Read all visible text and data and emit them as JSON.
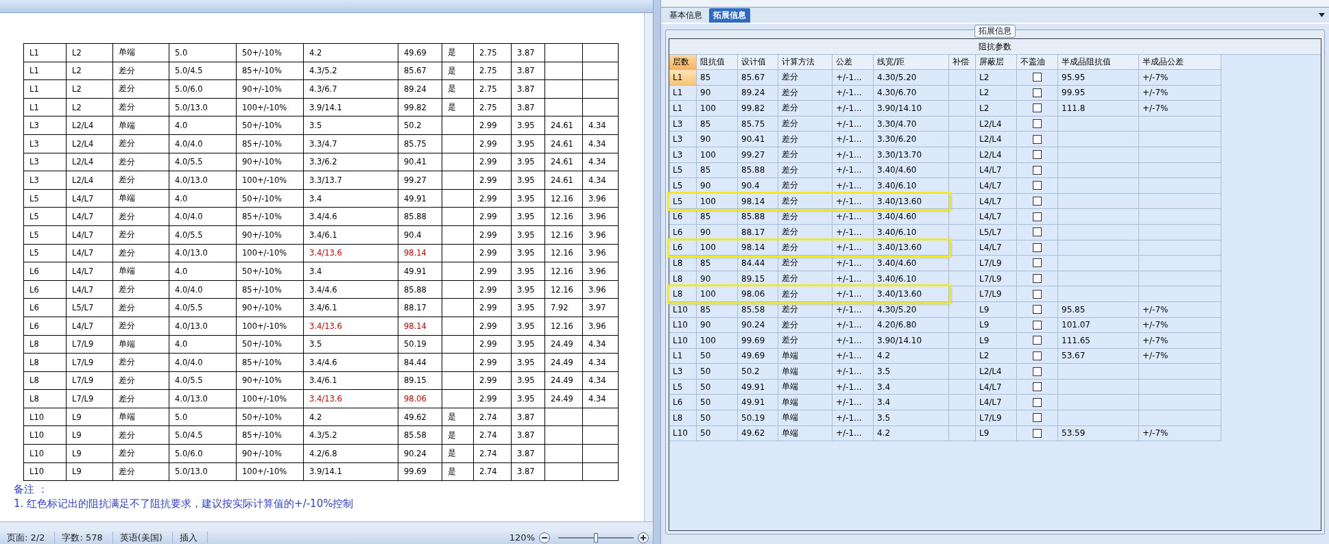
{
  "document": {
    "table": {
      "rows": [
        {
          "cells": [
            "L1",
            "L2",
            "单端",
            "5.0",
            "50+/-10%",
            "4.2",
            "49.69",
            "是",
            "2.75",
            "3.87",
            null,
            null
          ],
          "flagged": false
        },
        {
          "cells": [
            "L1",
            "L2",
            "差分",
            "5.0/4.5",
            "85+/-10%",
            "4.3/5.2",
            "85.67",
            "是",
            "2.75",
            "3.87",
            null,
            null
          ],
          "flagged": false
        },
        {
          "cells": [
            "L1",
            "L2",
            "差分",
            "5.0/6.0",
            "90+/-10%",
            "4.3/6.7",
            "89.24",
            "是",
            "2.75",
            "3.87",
            null,
            null
          ],
          "flagged": false
        },
        {
          "cells": [
            "L1",
            "L2",
            "差分",
            "5.0/13.0",
            "100+/-10%",
            "3.9/14.1",
            "99.82",
            "是",
            "2.75",
            "3.87",
            null,
            null
          ],
          "flagged": false
        },
        {
          "cells": [
            "L3",
            "L2/L4",
            "单端",
            "4.0",
            "50+/-10%",
            "3.5",
            "50.2",
            null,
            "2.99",
            "3.95",
            "24.61",
            "4.34"
          ],
          "flagged": false
        },
        {
          "cells": [
            "L3",
            "L2/L4",
            "差分",
            "4.0/4.0",
            "85+/-10%",
            "3.3/4.7",
            "85.75",
            null,
            "2.99",
            "3.95",
            "24.61",
            "4.34"
          ],
          "flagged": false
        },
        {
          "cells": [
            "L3",
            "L2/L4",
            "差分",
            "4.0/5.5",
            "90+/-10%",
            "3.3/6.2",
            "90.41",
            null,
            "2.99",
            "3.95",
            "24.61",
            "4.34"
          ],
          "flagged": false
        },
        {
          "cells": [
            "L3",
            "L2/L4",
            "差分",
            "4.0/13.0",
            "100+/-10%",
            "3.3/13.7",
            "99.27",
            null,
            "2.99",
            "3.95",
            "24.61",
            "4.34"
          ],
          "flagged": false
        },
        {
          "cells": [
            "L5",
            "L4/L7",
            "单端",
            "4.0",
            "50+/-10%",
            "3.4",
            "49.91",
            null,
            "2.99",
            "3.95",
            "12.16",
            "3.96"
          ],
          "flagged": false
        },
        {
          "cells": [
            "L5",
            "L4/L7",
            "差分",
            "4.0/4.0",
            "85+/-10%",
            "3.4/4.6",
            "85.88",
            null,
            "2.99",
            "3.95",
            "12.16",
            "3.96"
          ],
          "flagged": false
        },
        {
          "cells": [
            "L5",
            "L4/L7",
            "差分",
            "4.0/5.5",
            "90+/-10%",
            "3.4/6.1",
            "90.4",
            null,
            "2.99",
            "3.95",
            "12.16",
            "3.96"
          ],
          "flagged": false
        },
        {
          "cells": [
            "L5",
            "L4/L7",
            "差分",
            "4.0/13.0",
            "100+/-10%",
            "3.4/13.6",
            "98.14",
            null,
            "2.99",
            "3.95",
            "12.16",
            "3.96"
          ],
          "flagged": true
        },
        {
          "cells": [
            "L6",
            "L4/L7",
            "单端",
            "4.0",
            "50+/-10%",
            "3.4",
            "49.91",
            null,
            "2.99",
            "3.95",
            "12.16",
            "3.96"
          ],
          "flagged": false
        },
        {
          "cells": [
            "L6",
            "L4/L7",
            "差分",
            "4.0/4.0",
            "85+/-10%",
            "3.4/4.6",
            "85.88",
            null,
            "2.99",
            "3.95",
            "12.16",
            "3.96"
          ],
          "flagged": false
        },
        {
          "cells": [
            "L6",
            "L5/L7",
            "差分",
            "4.0/5.5",
            "90+/-10%",
            "3.4/6.1",
            "88.17",
            null,
            "2.99",
            "3.95",
            "7.92",
            "3.97"
          ],
          "flagged": false
        },
        {
          "cells": [
            "L6",
            "L4/L7",
            "差分",
            "4.0/13.0",
            "100+/-10%",
            "3.4/13.6",
            "98.14",
            null,
            "2.99",
            "3.95",
            "12.16",
            "3.96"
          ],
          "flagged": true
        },
        {
          "cells": [
            "L8",
            "L7/L9",
            "单端",
            "4.0",
            "50+/-10%",
            "3.5",
            "50.19",
            null,
            "2.99",
            "3.95",
            "24.49",
            "4.34"
          ],
          "flagged": false
        },
        {
          "cells": [
            "L8",
            "L7/L9",
            "差分",
            "4.0/4.0",
            "85+/-10%",
            "3.4/4.6",
            "84.44",
            null,
            "2.99",
            "3.95",
            "24.49",
            "4.34"
          ],
          "flagged": false
        },
        {
          "cells": [
            "L8",
            "L7/L9",
            "差分",
            "4.0/5.5",
            "90+/-10%",
            "3.4/6.1",
            "89.15",
            null,
            "2.99",
            "3.95",
            "24.49",
            "4.34"
          ],
          "flagged": false
        },
        {
          "cells": [
            "L8",
            "L7/L9",
            "差分",
            "4.0/13.0",
            "100+/-10%",
            "3.4/13.6",
            "98.06",
            null,
            "2.99",
            "3.95",
            "24.49",
            "4.34"
          ],
          "flagged": true
        },
        {
          "cells": [
            "L10",
            "L9",
            "单端",
            "5.0",
            "50+/-10%",
            "4.2",
            "49.62",
            "是",
            "2.74",
            "3.87",
            null,
            null
          ],
          "flagged": false
        },
        {
          "cells": [
            "L10",
            "L9",
            "差分",
            "5.0/4.5",
            "85+/-10%",
            "4.3/5.2",
            "85.58",
            "是",
            "2.74",
            "3.87",
            null,
            null
          ],
          "flagged": false
        },
        {
          "cells": [
            "L10",
            "L9",
            "差分",
            "5.0/6.0",
            "90+/-10%",
            "4.2/6.8",
            "90.24",
            "是",
            "2.74",
            "3.87",
            null,
            null
          ],
          "flagged": false
        },
        {
          "cells": [
            "L10",
            "L9",
            "差分",
            "5.0/13.0",
            "100+/-10%",
            "3.9/14.1",
            "99.69",
            "是",
            "2.74",
            "3.87",
            null,
            null
          ],
          "flagged": false
        }
      ]
    },
    "notes_heading": "备注 ：",
    "notes": [
      "1. 红色标记出的阻抗满足不了阻抗要求，建议按实际计算值的+/-10%控制"
    ]
  },
  "status_bar": {
    "page": "页面: 2/2",
    "word_count": "字数: 578",
    "language": "英语(美国)",
    "mode": "插入",
    "zoom": "120%",
    "zoom_slider": {
      "level": 0.5
    }
  },
  "panel": {
    "tabs": [
      {
        "label": "基本信息",
        "selected": false
      },
      {
        "label": "拓展信息",
        "selected": true
      }
    ],
    "group_title": "拓展信息",
    "grid": {
      "title": "阻抗参数",
      "columns": [
        {
          "label": "层数",
          "selected": true,
          "kind": "text"
        },
        {
          "label": "阻抗值",
          "selected": false,
          "kind": "text"
        },
        {
          "label": "设计值",
          "selected": false,
          "kind": "text"
        },
        {
          "label": "计算方法",
          "selected": false,
          "kind": "text"
        },
        {
          "label": "公差",
          "selected": false,
          "kind": "text"
        },
        {
          "label": "线宽/距",
          "selected": false,
          "kind": "text"
        },
        {
          "label": "补偿",
          "selected": false,
          "kind": "text"
        },
        {
          "label": "屏蔽层",
          "selected": false,
          "kind": "text"
        },
        {
          "label": "不盖油",
          "selected": false,
          "kind": "checkbox"
        },
        {
          "label": "半成品阻抗值",
          "selected": false,
          "kind": "text"
        },
        {
          "label": "半成品公差",
          "selected": false,
          "kind": "text"
        }
      ],
      "rows": [
        {
          "cells": [
            "L1",
            "85",
            "85.67",
            "差分",
            "+/-1...",
            "4.30/5.20",
            null,
            "L2",
            null,
            "95.95",
            "+/-7%"
          ],
          "checked": false,
          "highlighted": false,
          "focused": true
        },
        {
          "cells": [
            "L1",
            "90",
            "89.24",
            "差分",
            "+/-1...",
            "4.30/6.70",
            null,
            "L2",
            null,
            "99.95",
            "+/-7%"
          ],
          "checked": false,
          "highlighted": false,
          "focused": false
        },
        {
          "cells": [
            "L1",
            "100",
            "99.82",
            "差分",
            "+/-1...",
            "3.90/14.10",
            null,
            "L2",
            null,
            "111.8",
            "+/-7%"
          ],
          "checked": false,
          "highlighted": false,
          "focused": false
        },
        {
          "cells": [
            "L3",
            "85",
            "85.75",
            "差分",
            "+/-1...",
            "3.30/4.70",
            null,
            "L2/L4",
            null,
            null,
            null
          ],
          "checked": false,
          "highlighted": false,
          "focused": false
        },
        {
          "cells": [
            "L3",
            "90",
            "90.41",
            "差分",
            "+/-1...",
            "3.30/6.20",
            null,
            "L2/L4",
            null,
            null,
            null
          ],
          "checked": false,
          "highlighted": false,
          "focused": false
        },
        {
          "cells": [
            "L3",
            "100",
            "99.27",
            "差分",
            "+/-1...",
            "3.30/13.70",
            null,
            "L2/L4",
            null,
            null,
            null
          ],
          "checked": false,
          "highlighted": false,
          "focused": false
        },
        {
          "cells": [
            "L5",
            "85",
            "85.88",
            "差分",
            "+/-1...",
            "3.40/4.60",
            null,
            "L4/L7",
            null,
            null,
            null
          ],
          "checked": false,
          "highlighted": false,
          "focused": false
        },
        {
          "cells": [
            "L5",
            "90",
            "90.4",
            "差分",
            "+/-1...",
            "3.40/6.10",
            null,
            "L4/L7",
            null,
            null,
            null
          ],
          "checked": false,
          "highlighted": false,
          "focused": false
        },
        {
          "cells": [
            "L5",
            "100",
            "98.14",
            "差分",
            "+/-1...",
            "3.40/13.60",
            null,
            "L4/L7",
            null,
            null,
            null
          ],
          "checked": false,
          "highlighted": true,
          "focused": false
        },
        {
          "cells": [
            "L6",
            "85",
            "85.88",
            "差分",
            "+/-1...",
            "3.40/4.60",
            null,
            "L4/L7",
            null,
            null,
            null
          ],
          "checked": false,
          "highlighted": false,
          "focused": false
        },
        {
          "cells": [
            "L6",
            "90",
            "88.17",
            "差分",
            "+/-1...",
            "3.40/6.10",
            null,
            "L5/L7",
            null,
            null,
            null
          ],
          "checked": false,
          "highlighted": false,
          "focused": false
        },
        {
          "cells": [
            "L6",
            "100",
            "98.14",
            "差分",
            "+/-1...",
            "3.40/13.60",
            null,
            "L4/L7",
            null,
            null,
            null
          ],
          "checked": false,
          "highlighted": true,
          "focused": false
        },
        {
          "cells": [
            "L8",
            "85",
            "84.44",
            "差分",
            "+/-1...",
            "3.40/4.60",
            null,
            "L7/L9",
            null,
            null,
            null
          ],
          "checked": false,
          "highlighted": false,
          "focused": false
        },
        {
          "cells": [
            "L8",
            "90",
            "89.15",
            "差分",
            "+/-1...",
            "3.40/6.10",
            null,
            "L7/L9",
            null,
            null,
            null
          ],
          "checked": false,
          "highlighted": false,
          "focused": false
        },
        {
          "cells": [
            "L8",
            "100",
            "98.06",
            "差分",
            "+/-1...",
            "3.40/13.60",
            null,
            "L7/L9",
            null,
            null,
            null
          ],
          "checked": false,
          "highlighted": true,
          "focused": false
        },
        {
          "cells": [
            "L10",
            "85",
            "85.58",
            "差分",
            "+/-1...",
            "4.30/5.20",
            null,
            "L9",
            null,
            "95.85",
            "+/-7%"
          ],
          "checked": false,
          "highlighted": false,
          "focused": false
        },
        {
          "cells": [
            "L10",
            "90",
            "90.24",
            "差分",
            "+/-1...",
            "4.20/6.80",
            null,
            "L9",
            null,
            "101.07",
            "+/-7%"
          ],
          "checked": false,
          "highlighted": false,
          "focused": false
        },
        {
          "cells": [
            "L10",
            "100",
            "99.69",
            "差分",
            "+/-1...",
            "3.90/14.10",
            null,
            "L9",
            null,
            "111.65",
            "+/-7%"
          ],
          "checked": false,
          "highlighted": false,
          "focused": false
        },
        {
          "cells": [
            "L1",
            "50",
            "49.69",
            "单端",
            "+/-1...",
            "4.2",
            null,
            "L2",
            null,
            "53.67",
            "+/-7%"
          ],
          "checked": false,
          "highlighted": false,
          "focused": false
        },
        {
          "cells": [
            "L3",
            "50",
            "50.2",
            "单端",
            "+/-1...",
            "3.5",
            null,
            "L2/L4",
            null,
            null,
            null
          ],
          "checked": false,
          "highlighted": false,
          "focused": false
        },
        {
          "cells": [
            "L5",
            "50",
            "49.91",
            "单端",
            "+/-1...",
            "3.4",
            null,
            "L4/L7",
            null,
            null,
            null
          ],
          "checked": false,
          "highlighted": false,
          "focused": false
        },
        {
          "cells": [
            "L6",
            "50",
            "49.91",
            "单端",
            "+/-1...",
            "3.4",
            null,
            "L4/L7",
            null,
            null,
            null
          ],
          "checked": false,
          "highlighted": false,
          "focused": false
        },
        {
          "cells": [
            "L8",
            "50",
            "50.19",
            "单端",
            "+/-1...",
            "3.5",
            null,
            "L7/L9",
            null,
            null,
            null
          ],
          "checked": false,
          "highlighted": false,
          "focused": false
        },
        {
          "cells": [
            "L10",
            "50",
            "49.62",
            "单端",
            "+/-1...",
            "4.2",
            null,
            "L9",
            null,
            "53.59",
            "+/-7%"
          ],
          "checked": false,
          "highlighted": false,
          "focused": false
        }
      ]
    }
  }
}
